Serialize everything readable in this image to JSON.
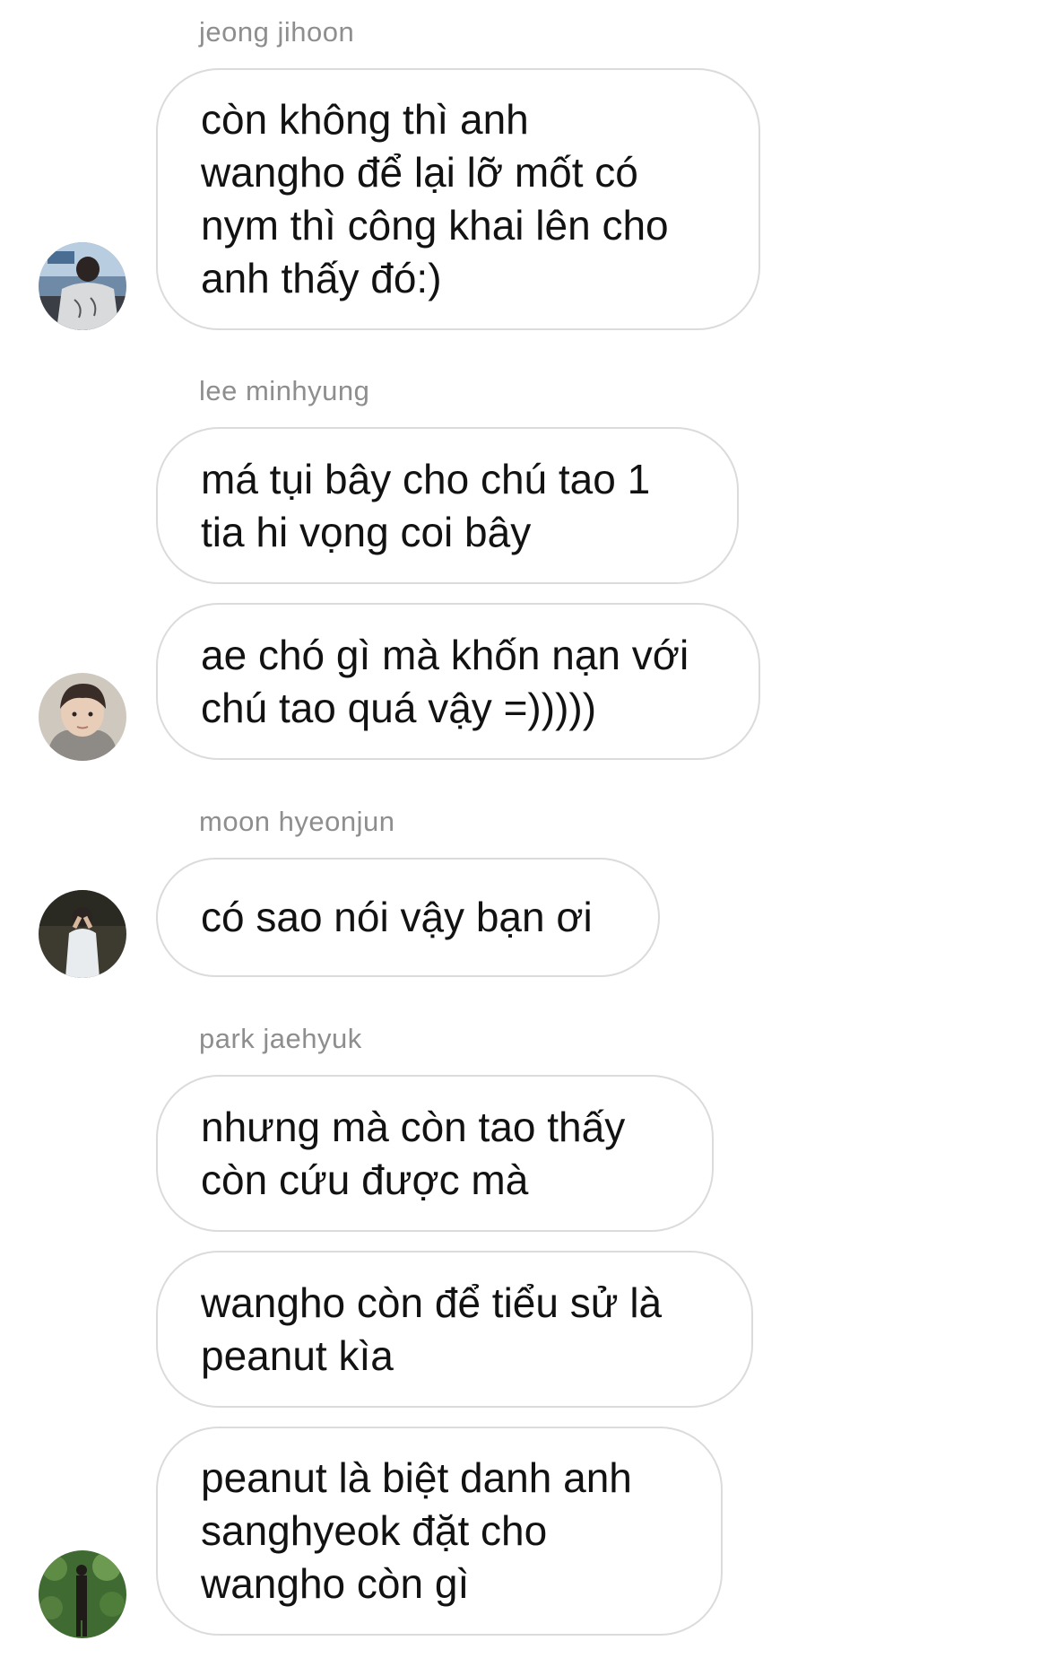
{
  "groups": [
    {
      "sender": "jeong jihoon",
      "avatar_icon": "user-avatar-icon",
      "messages": [
        "còn không thì anh\nwangho để lại lỡ mốt có\nnym thì công khai lên cho\nanh thấy đó:)"
      ]
    },
    {
      "sender": "lee minhyung",
      "avatar_icon": "user-avatar-icon",
      "messages": [
        "má tụi bây cho chú tao 1\ntia hi vọng coi bây",
        "ae chó gì mà khốn nạn với\nchú tao quá vậy =)))))"
      ]
    },
    {
      "sender": "moon hyeonjun",
      "avatar_icon": "user-avatar-icon",
      "messages": [
        "có sao nói vậy bạn ơi"
      ]
    },
    {
      "sender": "park jaehyuk",
      "avatar_icon": "user-avatar-icon",
      "messages": [
        "nhưng mà còn tao thấy\ncòn cứu được mà",
        "wangho còn để tiểu sử là\npeanut kìa",
        "peanut là biệt danh anh\nsanghyeok đặt cho\nwangho còn gì"
      ]
    }
  ],
  "colors": {
    "background": "#ffffff",
    "bubble_border": "#dbdbdb",
    "sender_text": "#8e8e8e",
    "message_text": "#121212"
  }
}
